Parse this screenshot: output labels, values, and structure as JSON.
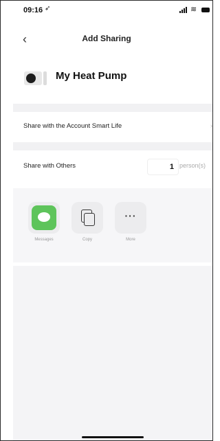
{
  "status_bar": {
    "time": "09:16",
    "location_glyph": "➶"
  },
  "nav": {
    "back_glyph": "‹",
    "title": "Add Sharing"
  },
  "device": {
    "name": "My Heat Pump"
  },
  "rows": {
    "account": {
      "label": "Share with the Account Smart Life",
      "chevron": "›"
    },
    "others": {
      "label": "Share with Others",
      "count": "1",
      "unit": "person(s)"
    }
  },
  "share_options": [
    {
      "label": "Messages",
      "icon": "messages-icon"
    },
    {
      "label": "Copy",
      "icon": "copy-icon"
    },
    {
      "label": "More",
      "icon": "more-icon"
    }
  ],
  "more_glyph": "···",
  "colors": {
    "messages_green": "#5ec45b",
    "separator_gray": "#f1f1f3"
  }
}
